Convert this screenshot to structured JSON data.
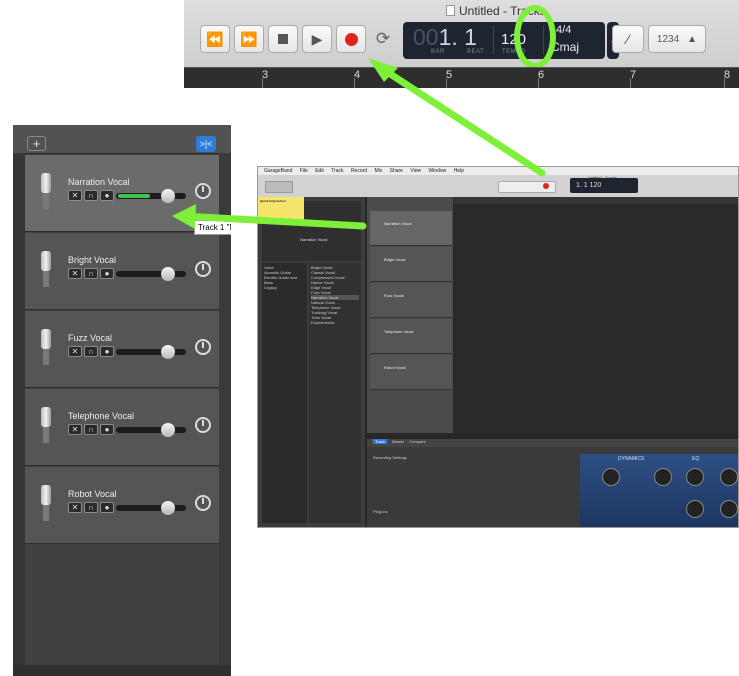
{
  "top_toolbar": {
    "window_title": "Untitled - Tracks",
    "lcd": {
      "bar_dim": "00",
      "bar_value": "1. 1",
      "bar_label": "BAR",
      "beat_label": "BEAT",
      "tempo": "120",
      "tempo_label": "TEMPO",
      "time_signature": "4/4",
      "key": "Cmaj"
    },
    "count_in": "1234",
    "ruler_marks": [
      "3",
      "4",
      "5",
      "6",
      "7",
      "8"
    ]
  },
  "track_panel": {
    "tracks": [
      {
        "name": "Narration Vocal",
        "selected": true
      },
      {
        "name": "Bright Vocal",
        "selected": false
      },
      {
        "name": "Fuzz Vocal",
        "selected": false
      },
      {
        "name": "Telephone Vocal",
        "selected": false
      },
      {
        "name": "Robot Vocal",
        "selected": false
      }
    ],
    "tooltip": "Track 1 \"N"
  },
  "full_app": {
    "menu": [
      "GarageBand",
      "File",
      "Edit",
      "Track",
      "Record",
      "Mix",
      "Share",
      "View",
      "Window",
      "Help"
    ],
    "title": "Untitled - Tracks",
    "lcd": "1. 1   120",
    "quick_help": "Quick Help button",
    "library_label": "Narration Vocal",
    "library_categories": [
      "Voice",
      "Acoustic Guitar",
      "Electric Guitar and Bass",
      "Legacy"
    ],
    "library_presets": [
      "Bright Vocal",
      "Classic Vocal",
      "Compressed Vocal",
      "Dance Vocal",
      "Edge Vocal",
      "Fuzz Vocal",
      "Narration Vocal",
      "Natural Vocal",
      "Telephone Vocal",
      "Tracking Vocal",
      "Tube Vocal",
      "Experimental"
    ],
    "tracks": [
      "Narration Vocal",
      "Bright Vocal",
      "Fuzz Vocal",
      "Telephone Vocal",
      "Robot Vocal"
    ],
    "editor_tabs": [
      "Track",
      "Master",
      "Compare"
    ],
    "editor_items": [
      "Recording Settings",
      "Plug-ins"
    ],
    "plugin_sections": [
      "DYNAMICS",
      "EQ"
    ]
  },
  "colors": {
    "highlight": "#7ef03a",
    "record": "#e0231c",
    "accent": "#2e7bd9"
  }
}
